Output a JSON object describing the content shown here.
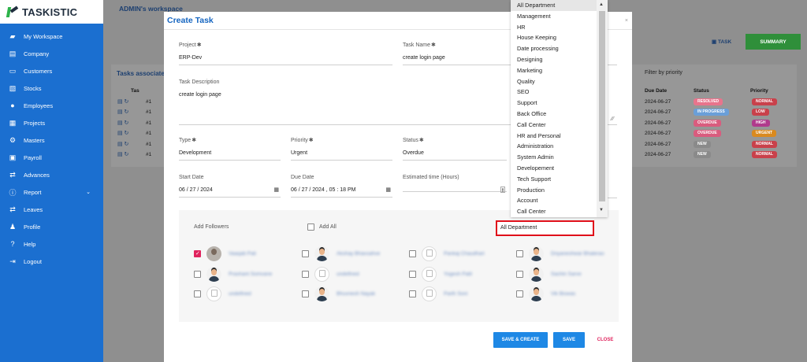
{
  "app": {
    "name": "TASKISTIC"
  },
  "sidebar": {
    "items": [
      {
        "label": "My Workspace",
        "icon": "briefcase-icon",
        "glyph": "▰"
      },
      {
        "label": "Company",
        "icon": "store-icon",
        "glyph": "▤"
      },
      {
        "label": "Customers",
        "icon": "id-card-icon",
        "glyph": "▭"
      },
      {
        "label": "Stocks",
        "icon": "clipboard-icon",
        "glyph": "▧"
      },
      {
        "label": "Employees",
        "icon": "users-icon",
        "glyph": "●"
      },
      {
        "label": "Projects",
        "icon": "building-icon",
        "glyph": "▦"
      },
      {
        "label": "Masters",
        "icon": "gear-icon",
        "glyph": "⚙"
      },
      {
        "label": "Payroll",
        "icon": "calendar-icon",
        "glyph": "▣"
      },
      {
        "label": "Advances",
        "icon": "exchange-icon",
        "glyph": "⇄"
      },
      {
        "label": "Report",
        "icon": "info-circle-icon",
        "glyph": "ⓘ",
        "has_chevron": true
      },
      {
        "label": "Leaves",
        "icon": "exchange-icon",
        "glyph": "⇄"
      },
      {
        "label": "Profile",
        "icon": "user-gear-icon",
        "glyph": "♟"
      },
      {
        "label": "Help",
        "icon": "question-circle-icon",
        "glyph": "?"
      },
      {
        "label": "Logout",
        "icon": "logout-icon",
        "glyph": "⇥"
      }
    ],
    "chevron": "⌄"
  },
  "background": {
    "header_title": "ADMIN's workspace",
    "panel_title": "Tasks associate",
    "filter_label": "Filter by priority",
    "task_button": "TASK",
    "summary_button": "SUMMARY",
    "table_headers": {
      "task": "Tas",
      "due": "e",
      "due_date": "Due Date",
      "status": "Status",
      "priority": "Priority"
    },
    "rows": [
      {
        "id": "#1",
        "e": "e",
        "due_date": "2024-06-27",
        "status": "RESOLVED",
        "priority": "NORMAL"
      },
      {
        "id": "#1",
        "e": "e",
        "due_date": "2024-06-27",
        "status": "IN PROGRESS",
        "priority": "LOW"
      },
      {
        "id": "#1",
        "e": "e",
        "due_date": "2024-06-27",
        "status": "OVERDUE",
        "priority": "HIGH"
      },
      {
        "id": "#1",
        "e": "e",
        "due_date": "2024-06-27",
        "status": "OVERDUE",
        "priority": "URGENT"
      },
      {
        "id": "#1",
        "e": "e",
        "due_date": "2024-06-27",
        "status": "NEW",
        "priority": "NORMAL"
      },
      {
        "id": "#1",
        "e": "e",
        "due_date": "2024-06-27",
        "status": "NEW",
        "priority": "NORMAL"
      }
    ],
    "status_colors": {
      "RESOLVED": "#e8748c",
      "IN PROGRESS": "#6a9fd8",
      "OVERDUE": "#d95c7e",
      "NEW": "#8a8a8a"
    },
    "priority_colors": {
      "NORMAL": "#c9414b",
      "LOW": "#c9414b",
      "HIGH": "#b03a8c",
      "URGENT": "#d98a1f"
    }
  },
  "modal": {
    "title": "Create Task",
    "close_x": "×",
    "project": {
      "label": "Project",
      "value": "ERP-Dev"
    },
    "task_name": {
      "label": "Task Name",
      "value": "create login page"
    },
    "description": {
      "label": "Task Description",
      "value": "create login page"
    },
    "type": {
      "label": "Type",
      "value": "Development"
    },
    "priority": {
      "label": "Priority",
      "value": "Urgent"
    },
    "status": {
      "label": "Status",
      "value": "Overdue"
    },
    "start_date": {
      "label": "Start Date",
      "value": "06 / 27 / 2024"
    },
    "due_date": {
      "label": "Due Date",
      "value": "06 / 27 / 2024 , 05 : 18  PM"
    },
    "estimated_time": {
      "label": "Estimated time (Hours)",
      "value": ""
    },
    "required_mark": "✱",
    "calendar_glyph": "▦",
    "resize_glyph": "⁄⁄⁄",
    "spinner_up": "▲",
    "spinner_down": "▼",
    "followers": {
      "label": "Add Followers",
      "add_all": "Add All",
      "department_value": "All Department",
      "people": [
        {
          "name": "Vaaqab Pati",
          "avatar": "photo",
          "checked": true
        },
        {
          "name": "Akshay Bhavsahve",
          "avatar": "man",
          "checked": false
        },
        {
          "name": "Pankaj Chaudhari",
          "avatar": "blank",
          "checked": false
        },
        {
          "name": "Dnyaneshwar Bhalerao",
          "avatar": "man",
          "checked": false
        },
        {
          "name": "Prashant Somvane",
          "avatar": "man",
          "checked": false
        },
        {
          "name": "undefined",
          "avatar": "blank",
          "checked": false
        },
        {
          "name": "Yogesh Patil",
          "avatar": "blank",
          "checked": false
        },
        {
          "name": "Sachin Sarve",
          "avatar": "man",
          "checked": false
        },
        {
          "name": "undefined",
          "avatar": "blank",
          "checked": false
        },
        {
          "name": "Bhuvnesh Nayak",
          "avatar": "man",
          "checked": false
        },
        {
          "name": "Parth Soni",
          "avatar": "blank",
          "checked": false
        },
        {
          "name": "Vik Biswas",
          "avatar": "man",
          "checked": false
        }
      ]
    },
    "buttons": {
      "save_create": "SAVE & CREATE",
      "save": "SAVE",
      "close": "CLOSE"
    }
  },
  "department_dropdown": {
    "selected": "All Department",
    "options": [
      "All Department",
      "Management",
      "HR",
      "House Keeping",
      "Date processing",
      "Designing",
      "Marketing",
      "Quality",
      "SEO",
      "Support",
      "Back Office",
      "Call Center",
      "HR and Personal",
      "Administration",
      "System Admin",
      "Developement",
      "Tech Support",
      "Production",
      "Account",
      "Call Center"
    ],
    "scroll_up": "▲",
    "scroll_down": "▼"
  }
}
